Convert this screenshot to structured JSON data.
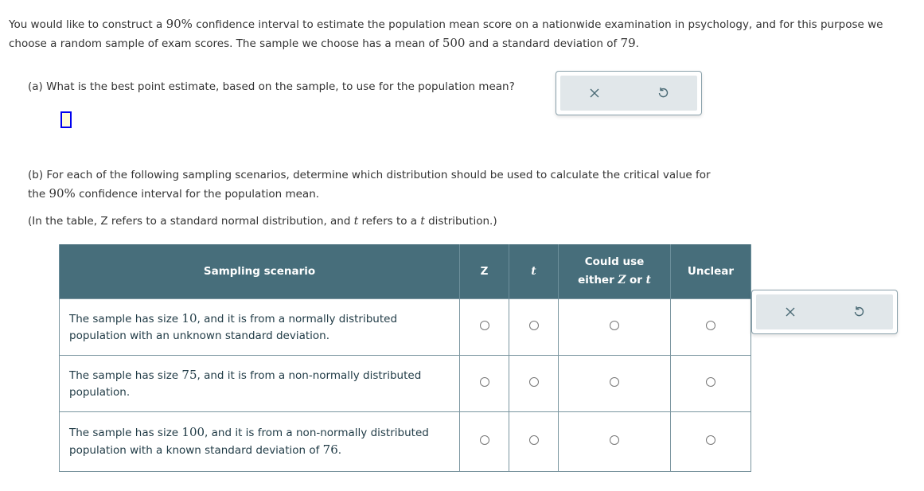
{
  "intro": {
    "part1": "You would like to construct a ",
    "conf": "90%",
    "part2": " confidence interval to estimate the population mean score on a nationwide examination in psychology, and for this purpose we choose a random sample of exam scores. The sample we choose has a mean of ",
    "mean": "500",
    "part3": " and a standard deviation of ",
    "sd": "79",
    "part4": "."
  },
  "part_a": {
    "question": "(a) What is the best point estimate, based on the sample, to use for the population mean?",
    "answer_value": ""
  },
  "tools": {
    "clear_icon": "×",
    "undo_icon": "↺"
  },
  "part_b": {
    "q1": "(b) For each of the following sampling scenarios, determine which distribution should be used to calculate the critical value for the ",
    "conf": "90%",
    "q2": " confidence interval for the population mean.",
    "note1": "(In the table, Z refers to a standard normal distribution, and ",
    "note_t1": "t",
    "note2": " refers to a ",
    "note_t2": "t",
    "note3": " distribution.)"
  },
  "table": {
    "headers": {
      "scenario": "Sampling scenario",
      "z": "Z",
      "t": "t",
      "either1": "Could use",
      "either2": "either ",
      "either_z": "Z",
      "either_or": " or ",
      "either_t": "t",
      "unclear": "Unclear"
    },
    "rows": [
      {
        "a": "The sample has size ",
        "n": "10",
        "b": ", and it is from a normally distributed population with an unknown standard deviation.",
        "c": "",
        "d": ""
      },
      {
        "a": "The sample has size ",
        "n": "75",
        "b": ", and it is from a non-normally distributed population.",
        "c": "",
        "d": ""
      },
      {
        "a": "The sample has size ",
        "n": "100",
        "b": ", and it is from a non-normally distributed population with a known standard deviation of ",
        "c": "76",
        "d": "."
      }
    ]
  }
}
